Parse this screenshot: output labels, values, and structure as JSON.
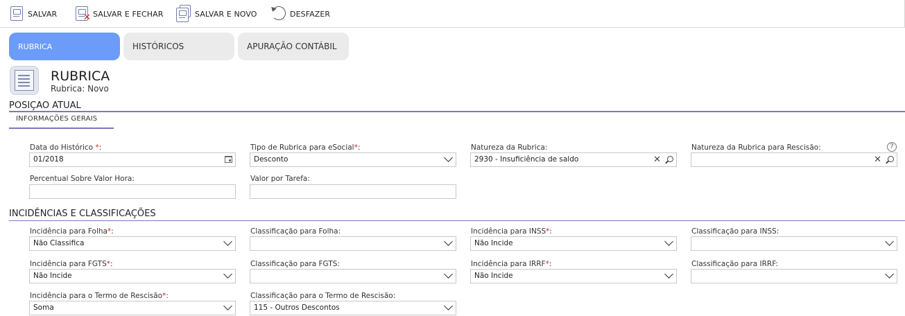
{
  "toolbar": {
    "save_label": "SALVAR",
    "save_close_label": "SALVAR E FECHAR",
    "save_new_label": "SALVAR E NOVO",
    "undo_label": "DESFAZER"
  },
  "tabs": [
    {
      "label": "RUBRICA",
      "active": true
    },
    {
      "label": "HISTÓRICOS",
      "active": false
    },
    {
      "label": "APURAÇÃO CONTÁBIL",
      "active": false
    }
  ],
  "header": {
    "title": "RUBRICA",
    "subtitle": "Rubrica: Novo"
  },
  "section_position": {
    "title": "POSIÇAO ATUAL",
    "subtab": "INFORMAÇÕES GERAIS"
  },
  "general": {
    "data_historico": {
      "label": "Data do Histórico ",
      "required": "*",
      "suffix": ":",
      "value": "01/2018"
    },
    "tipo_rubrica": {
      "label": "Tipo de Rubrica para eSocial",
      "required": "*",
      "suffix": ":",
      "value": "Desconto"
    },
    "natureza": {
      "label": "Natureza da Rubrica:",
      "value": "2930 - Insuficiência de saldo"
    },
    "natureza_rescisao": {
      "label": "Natureza da Rubrica para Rescisão:",
      "value": ""
    },
    "percentual": {
      "label": "Percentual Sobre Valor Hora:",
      "value": ""
    },
    "valor_tarefa": {
      "label": "Valor por Tarefa:",
      "value": ""
    },
    "help_glyph": "?"
  },
  "section_incidences": {
    "title": "INCIDÊNCIAS E CLASSIFICAÇÕES"
  },
  "incidences": {
    "inc_folha": {
      "label": "Incidência para Folha",
      "required": "*",
      "suffix": ":",
      "value": "Não Classifica"
    },
    "class_folha": {
      "label": "Classificação para Folha:",
      "value": ""
    },
    "inc_inss": {
      "label": "Incidência para INSS",
      "required": "*",
      "suffix": ":",
      "value": "Não Incide"
    },
    "class_inss": {
      "label": "Classificação para INSS:",
      "value": ""
    },
    "inc_fgts": {
      "label": "Incidência para FGTS",
      "required": "*",
      "suffix": ":",
      "value": "Não Incide"
    },
    "class_fgts": {
      "label": "Classificação para FGTS:",
      "value": ""
    },
    "inc_irrf": {
      "label": "Incidência para IRRF",
      "required": "*",
      "suffix": ":",
      "value": "Não Incide"
    },
    "class_irrf": {
      "label": "Classificação para IRRF:",
      "value": ""
    },
    "inc_rescisao": {
      "label": "Incidência para o Termo de Rescisão",
      "required": "*",
      "suffix": ":",
      "value": "Soma"
    },
    "class_rescisao": {
      "label": "Classificação para o Termo de Rescisão:",
      "value": "115 - Outros Descontos"
    }
  }
}
